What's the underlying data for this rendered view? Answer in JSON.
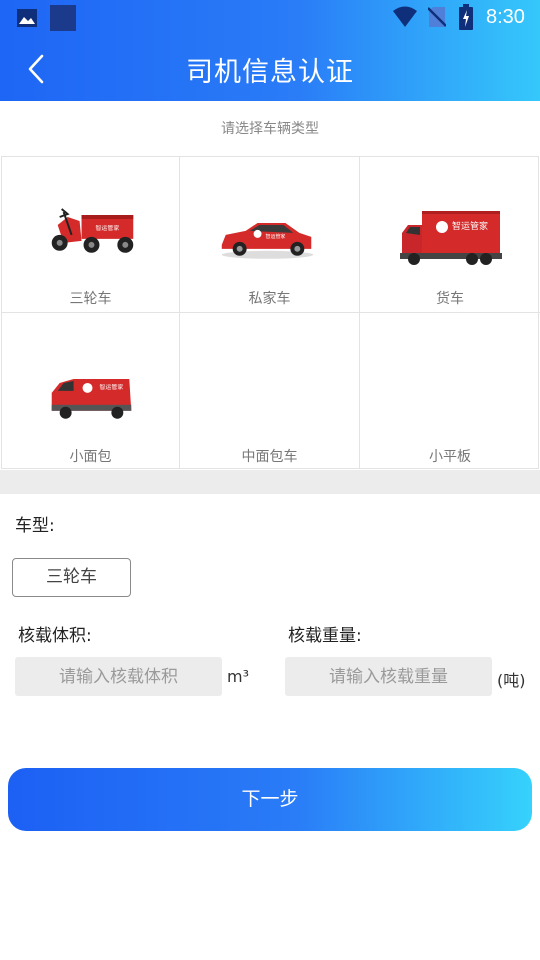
{
  "status_bar": {
    "time": "8:30",
    "icons": [
      "photo-icon",
      "app-square-icon",
      "wifi-icon",
      "no-sim-icon",
      "battery-icon"
    ]
  },
  "header": {
    "title": "司机信息认证",
    "back_icon": "chevron-left-icon"
  },
  "vehicle_select": {
    "hint": "请选择车辆类型",
    "types": [
      {
        "label": "三轮车",
        "image": "tricycle"
      },
      {
        "label": "私家车",
        "image": "sedan"
      },
      {
        "label": "货车",
        "image": "truck"
      },
      {
        "label": "小面包",
        "image": "minivan"
      },
      {
        "label": "中面包车",
        "image": ""
      },
      {
        "label": "小平板",
        "image": ""
      }
    ],
    "vehicle_logo_text": "智运管家"
  },
  "form": {
    "type_label": "车型:",
    "selected_type": "三轮车",
    "volume_label": "核载体积:",
    "volume_placeholder": "请输入核载体积",
    "volume_unit": "m³",
    "weight_label": "核载重量:",
    "weight_placeholder": "请输入核载重量",
    "weight_unit": "(吨)"
  },
  "next_button": {
    "label": "下一步"
  },
  "colors": {
    "primary_start": "#1e66f5",
    "primary_end": "#35c8fb",
    "vehicle_red": "#d42a2a"
  }
}
